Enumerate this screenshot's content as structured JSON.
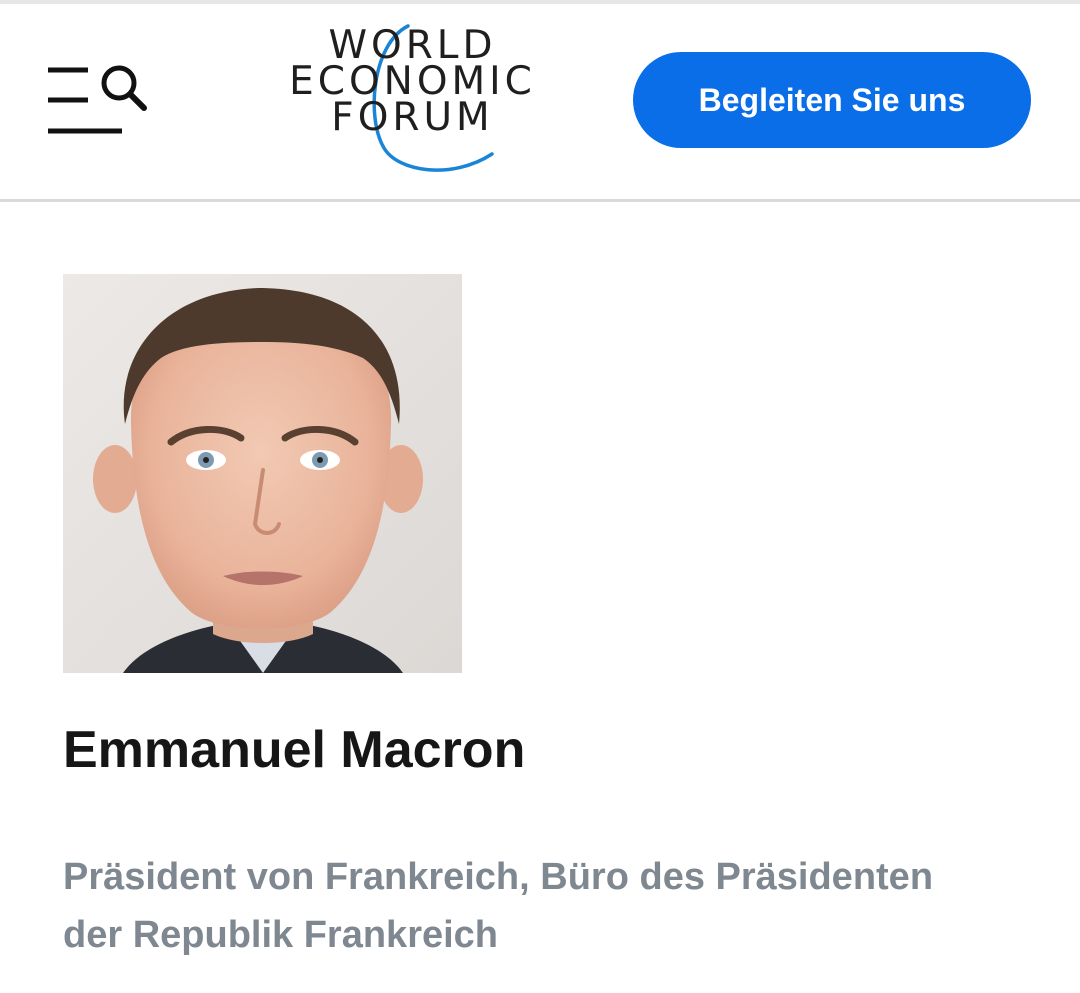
{
  "header": {
    "menu_icon": "hamburger-icon",
    "search_icon": "search-icon",
    "logo": {
      "line1": "WORLD",
      "line2": "ECONOMIC",
      "line3": "FORUM",
      "arc_color": "#1a84d6"
    },
    "cta_label": "Begleiten Sie uns",
    "cta_color": "#0a6ee8"
  },
  "profile": {
    "photo_alt": "Emmanuel Macron",
    "name": "Emmanuel Macron",
    "role_line1": "Präsident von Frankreich, Büro des Präsidenten",
    "role_line2": "der Republik Frankreich"
  }
}
